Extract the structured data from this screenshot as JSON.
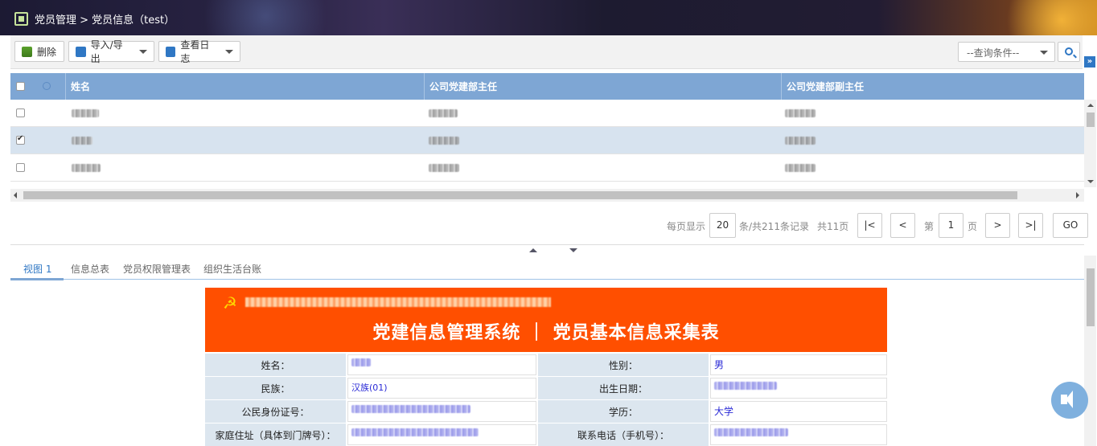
{
  "header": {
    "breadcrumb": "党员管理 > 党员信息（test）"
  },
  "toolbar": {
    "delete_label": "删除",
    "import_export_label": "导入/导出",
    "view_log_label": "查看日志",
    "query_select_value": "--查询条件--"
  },
  "grid": {
    "columns": [
      "姓名",
      "公司党建部主任",
      "公司党建部副主任"
    ],
    "rows": [
      {
        "checked": false,
        "selected": false
      },
      {
        "checked": true,
        "selected": true
      },
      {
        "checked": false,
        "selected": false
      }
    ]
  },
  "pager": {
    "per_page_label": "每页显示",
    "per_page_value": "20",
    "total_records": "条/共211条记录",
    "total_pages": "共11页",
    "page_prefix": "第",
    "page_value": "1",
    "page_suffix": "页",
    "go_label": "GO"
  },
  "tabs": [
    "视图 1",
    "信息总表",
    "党员权限管理表",
    "组织生活台账"
  ],
  "form": {
    "banner_title": "党建信息管理系统 ｜ 党员基本信息采集表",
    "fields": [
      {
        "label": "姓名：",
        "value": "",
        "label2": "性别：",
        "value2": "男"
      },
      {
        "label": "民族：",
        "value": "汉族(01)",
        "label2": "出生日期：",
        "value2": ""
      },
      {
        "label": "公民身份证号：",
        "value": "",
        "label2": "学历：",
        "value2": "大学"
      },
      {
        "label": "家庭住址（具体到门牌号）：",
        "value": "",
        "label2": "联系电话（手机号）：",
        "value2": ""
      }
    ]
  },
  "colors": {
    "accent": "#2f77c4",
    "grid_header": "#7ea6d4",
    "banner": "#ff4f00"
  }
}
